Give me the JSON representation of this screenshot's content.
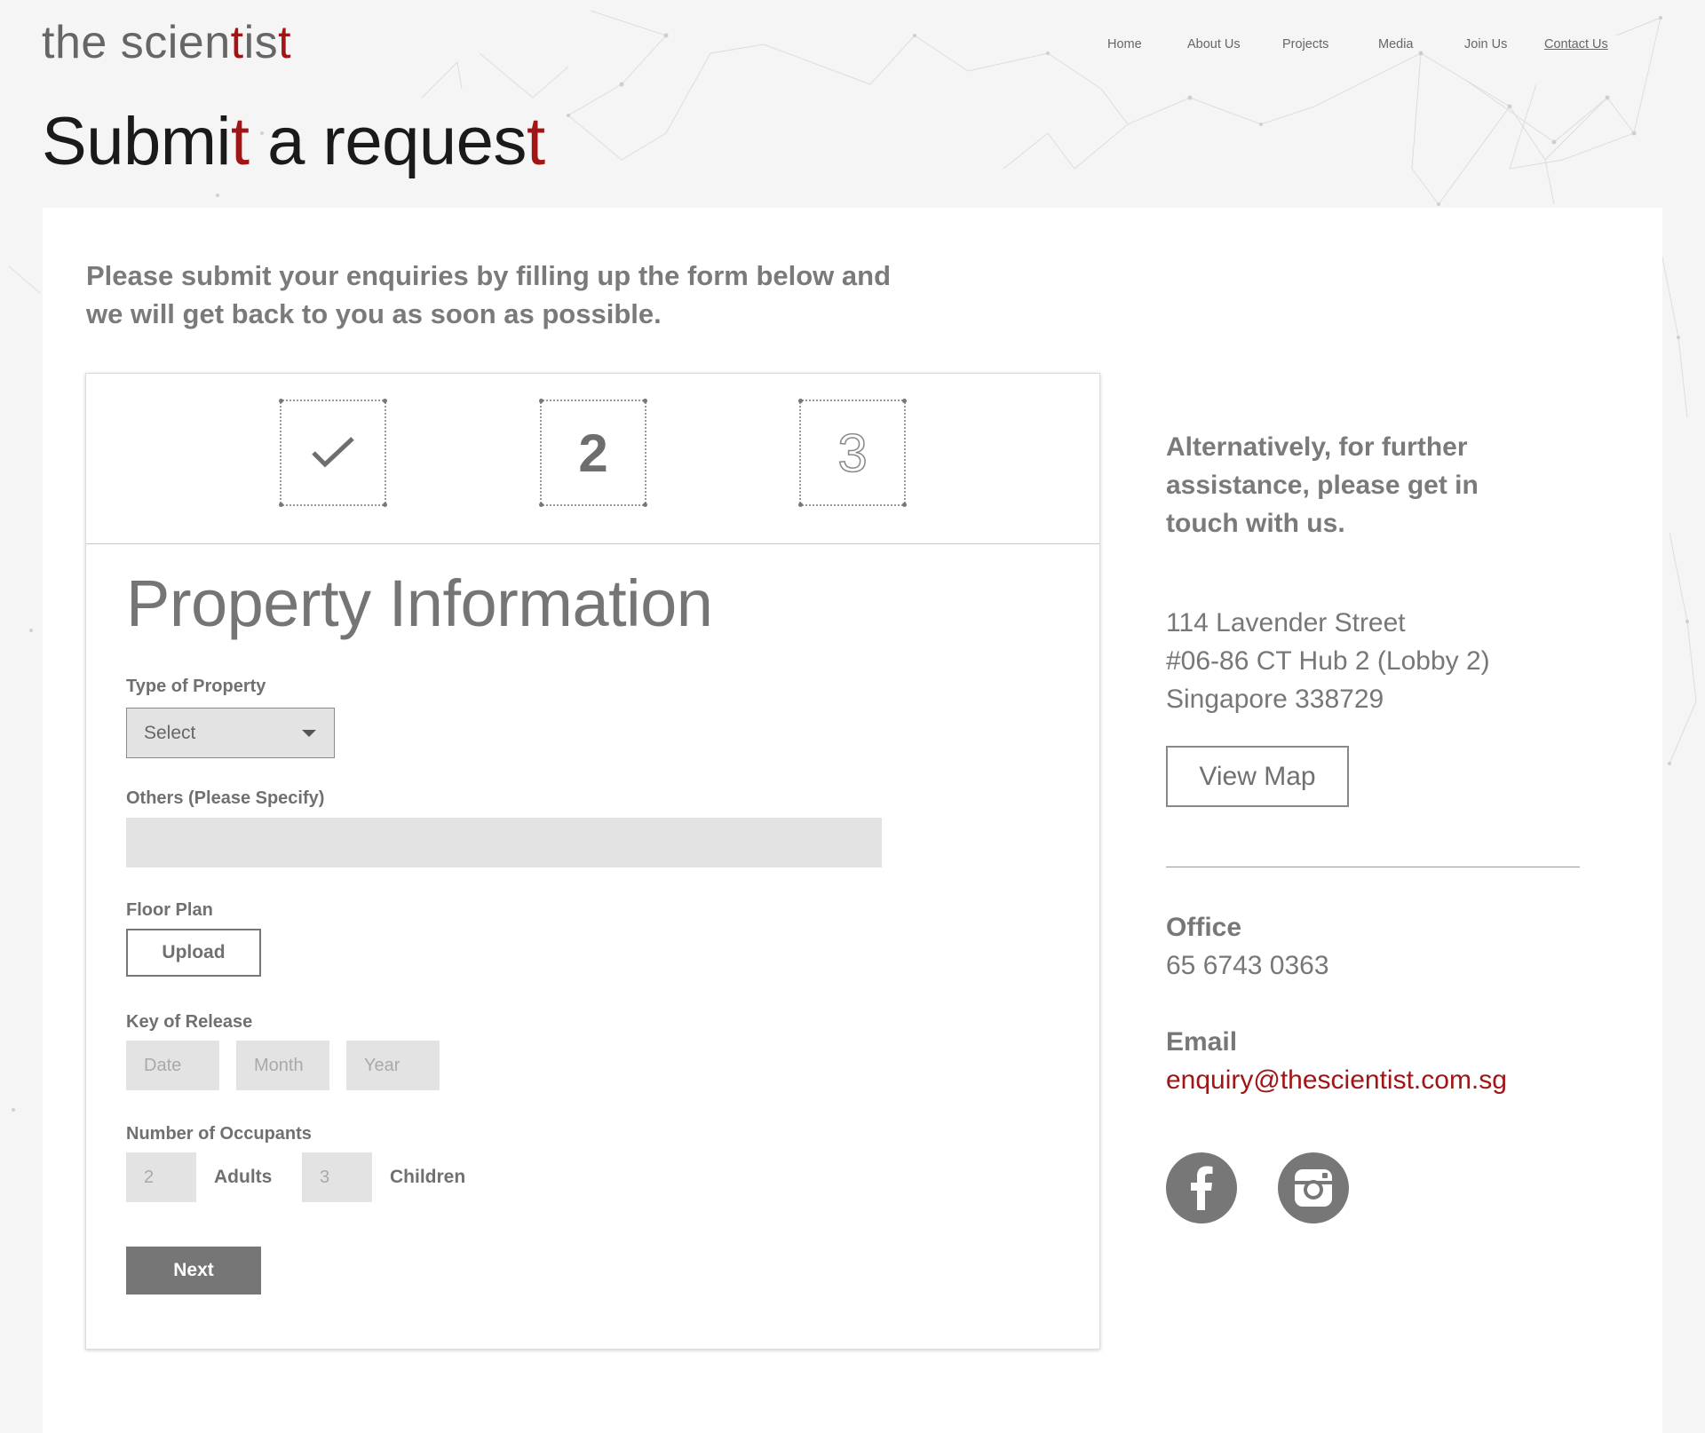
{
  "header": {
    "logo": {
      "part1": "the scien",
      "accent1": "t",
      "part2": "is",
      "accent2": "t"
    },
    "nav": [
      {
        "label": "Home"
      },
      {
        "label": "About Us"
      },
      {
        "label": "Projects"
      },
      {
        "label": "Media"
      },
      {
        "label": "Join Us"
      },
      {
        "label": "Contact Us",
        "active": true
      }
    ]
  },
  "page_title": {
    "part1": "Submi",
    "accent1": "t",
    "part2": " a reques",
    "accent2": "t"
  },
  "intro": "Please submit your enquiries by filling up the form below and we will get back to you as soon as possible.",
  "form": {
    "steps": [
      {
        "state": "completed",
        "icon": "check-icon"
      },
      {
        "state": "current",
        "label": "2"
      },
      {
        "state": "upcoming",
        "label": "3"
      }
    ],
    "section_title": "Property Information",
    "type_of_property": {
      "label": "Type of Property",
      "value": "Select"
    },
    "others": {
      "label": "Others (Please Specify)",
      "value": ""
    },
    "floor_plan": {
      "label": "Floor Plan",
      "button": "Upload"
    },
    "key_of_release": {
      "label": "Key of Release",
      "date": "Date",
      "month": "Month",
      "year": "Year"
    },
    "occupants": {
      "label": "Number of Occupants",
      "adults_value": "2",
      "adults_label": "Adults",
      "children_value": "3",
      "children_label": "Children"
    },
    "next_button": "Next"
  },
  "contact": {
    "intro": "Alternatively, for further assistance, please get in touch with us.",
    "address": [
      "114 Lavender Street",
      "#06-86 CT Hub 2 (Lobby 2)",
      "Singapore 338729"
    ],
    "map_button": "View Map",
    "office_label": "Office",
    "office_phone": "65 6743 0363",
    "email_label": "Email",
    "email": "enquiry@thescientist.com.sg",
    "social": [
      {
        "icon": "facebook-icon"
      },
      {
        "icon": "instagram-icon"
      }
    ]
  },
  "colors": {
    "accent": "#a01515",
    "text": "#777777",
    "field_bg": "#e3e3e3",
    "button": "#767676"
  }
}
